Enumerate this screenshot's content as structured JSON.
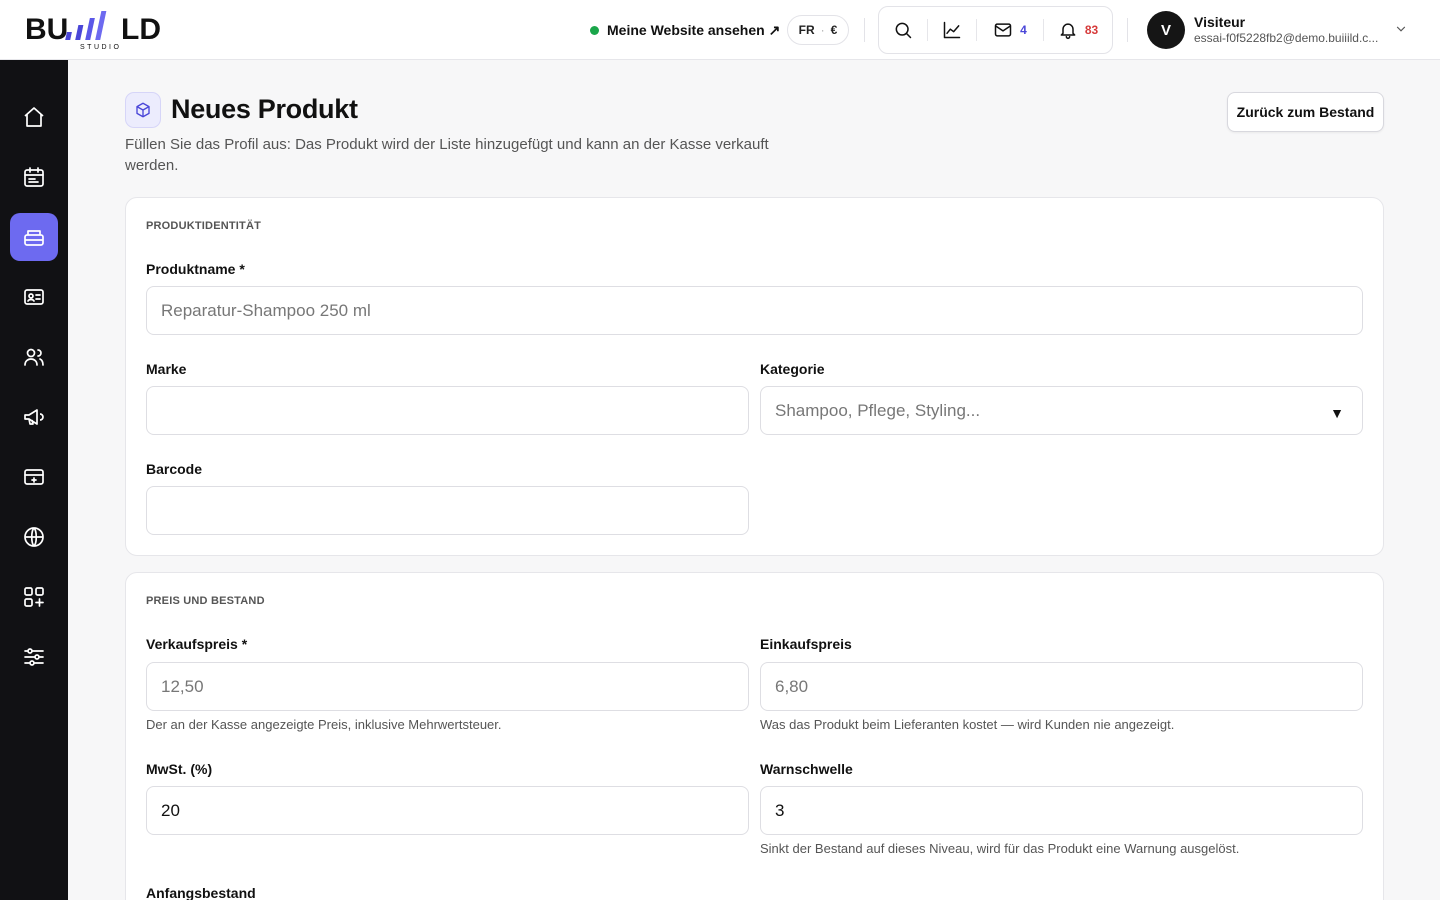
{
  "header": {
    "logo_text": "BUILD",
    "logo_sub": "STUDIO",
    "site_link": "Meine Website ansehen ↗",
    "lang": "FR",
    "currency": "€",
    "mail_count": "4",
    "notif_count": "83",
    "user_initial": "V",
    "user_name": "Visiteur",
    "user_email": "essai-f0f5228fb2@demo.buiiild.c..."
  },
  "page": {
    "title": "Neues Produkt",
    "subtitle": "Füllen Sie das Profil aus: Das Produkt wird der Liste hinzugefügt und kann an der Kasse verkauft werden.",
    "back_button": "Zurück zum Bestand"
  },
  "identity": {
    "section_title": "PRODUKTIDENTITÄT",
    "name_label": "Produktname *",
    "name_placeholder": "Reparatur-Shampoo 250 ml",
    "brand_label": "Marke",
    "brand_value": "",
    "category_label": "Kategorie",
    "category_placeholder": "Shampoo, Pflege, Styling...",
    "barcode_label": "Barcode",
    "barcode_value": ""
  },
  "pricing": {
    "section_title": "PREIS UND BESTAND",
    "sale_label": "Verkaufspreis *",
    "sale_placeholder": "12,50",
    "sale_help": "Der an der Kasse angezeigte Preis, inklusive Mehrwertsteuer.",
    "purchase_label": "Einkaufspreis",
    "purchase_placeholder": "6,80",
    "purchase_help": "Was das Produkt beim Lieferanten kostet — wird Kunden nie angezeigt.",
    "vat_label": "MwSt. (%)",
    "vat_value": "20",
    "threshold_label": "Warnschwelle",
    "threshold_value": "3",
    "threshold_help": "Sinkt der Bestand auf dieses Niveau, wird für das Produkt eine Warnung ausgelöst.",
    "initial_stock_label": "Anfangsbestand"
  },
  "colors": {
    "accent": "#6d6af0",
    "sidebar": "#111114",
    "status_green": "#1aa64a",
    "badge_blue": "#4a46d8",
    "badge_red": "#d63a3a"
  }
}
